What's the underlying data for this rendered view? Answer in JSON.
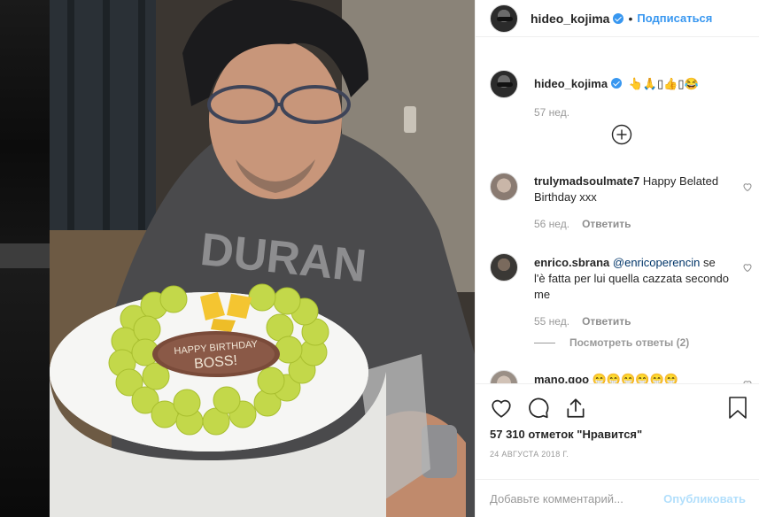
{
  "header": {
    "username": "hideo_kojima",
    "separator": "•",
    "follow_label": "Подписаться"
  },
  "caption": {
    "username": "hideo_kojima",
    "text": "👆🙏▯👍▯😂",
    "time": "57 нед."
  },
  "comments": [
    {
      "username": "trulymadsoulmate7",
      "text": "Happy Belated Birthday xxx",
      "time": "56 нед.",
      "reply_label": "Ответить"
    },
    {
      "username": "enrico.sbrana",
      "mention": "@enricoperencin",
      "text": "se l'è fatta per lui quella cazzata secondo me",
      "time": "55 нед.",
      "reply_label": "Ответить"
    },
    {
      "username": "mano.goo",
      "text": "😁😁😁😁😁😁"
    }
  ],
  "view_replies": "Посмотреть ответы (2)",
  "likes": "57 310 отметок \"Нравится\"",
  "date": "24 АВГУСТА 2018 Г.",
  "add_comment": {
    "placeholder": "Добавьте комментарий...",
    "post_label": "Опубликовать"
  },
  "photo": {
    "cake_text_line1": "HAPPY BIRTHDAY",
    "cake_text_line2": "BOSS!",
    "shirt_text": "DURAN"
  },
  "colors": {
    "link": "#3897f0",
    "post_disabled": "#b2dffc",
    "muted": "#999999"
  }
}
